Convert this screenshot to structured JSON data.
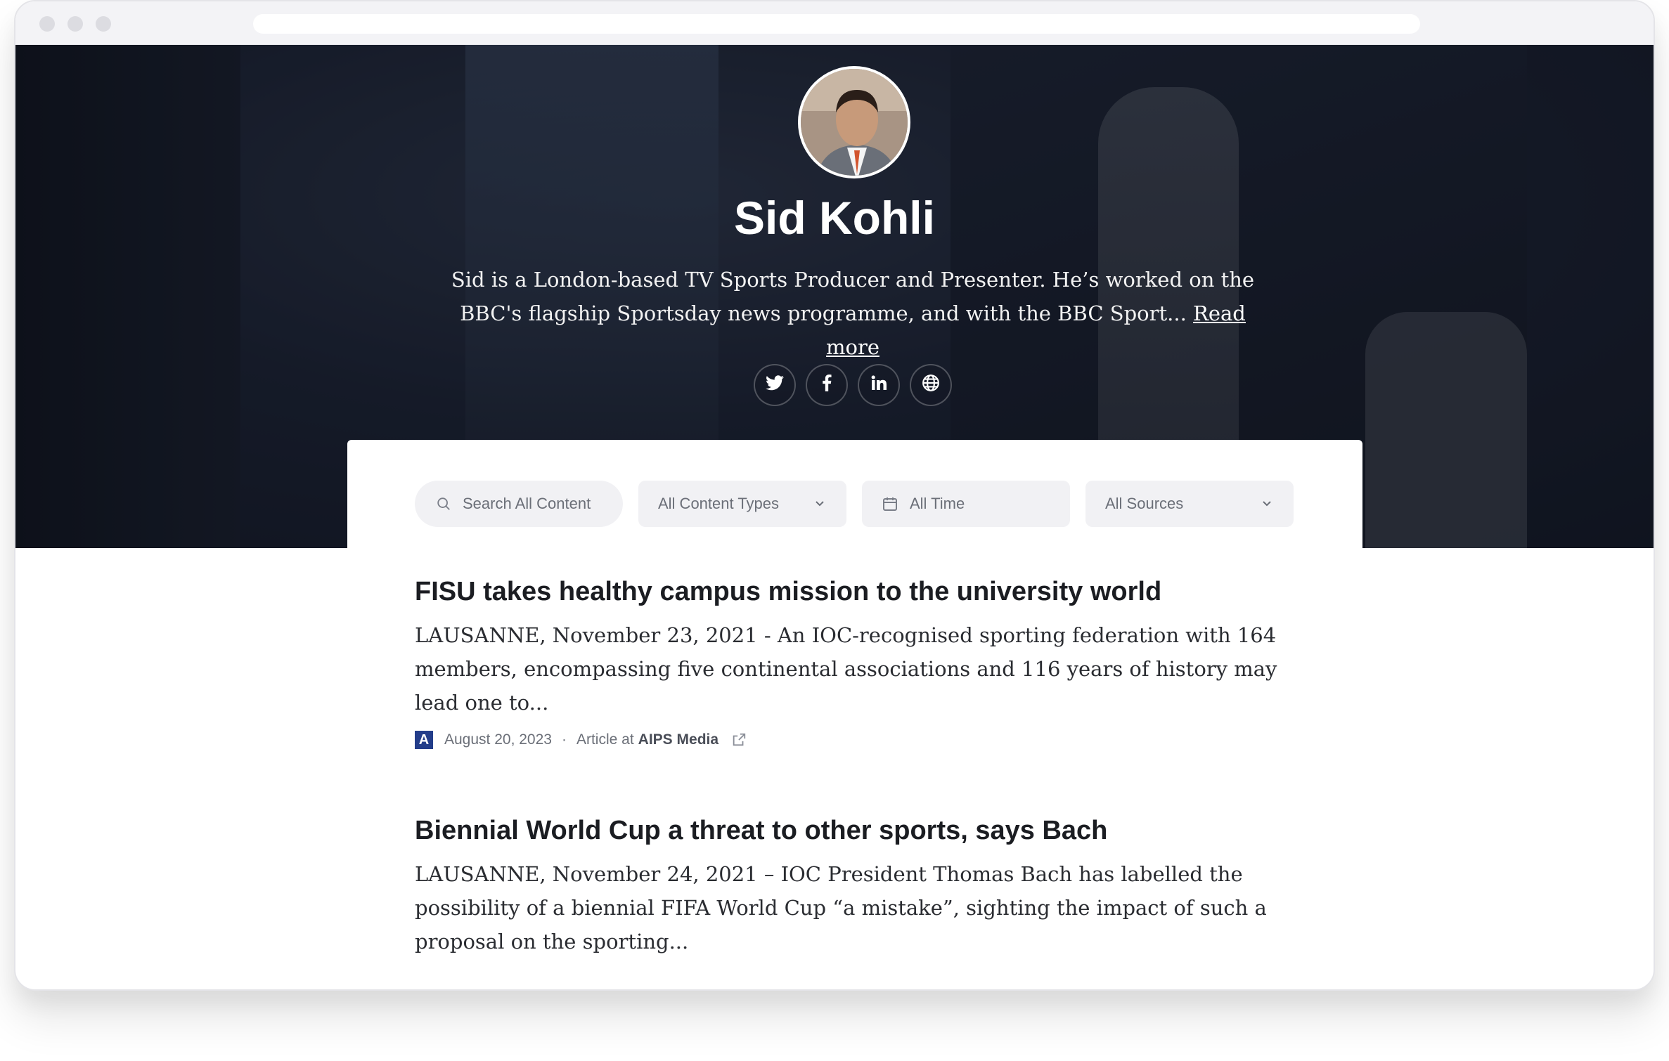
{
  "profile": {
    "name": "Sid Kohli",
    "bio": "Sid is a London-based TV Sports Producer and Presenter. He’s worked on the BBC's flagship Sportsday news programme, and with the BBC Sport...",
    "read_more": "Read more",
    "socials": [
      {
        "name": "twitter-icon"
      },
      {
        "name": "facebook-icon"
      },
      {
        "name": "linkedin-icon"
      },
      {
        "name": "globe-icon"
      }
    ]
  },
  "filters": {
    "search_placeholder": "Search All Content",
    "content_types": "All Content Types",
    "time": "All Time",
    "sources": "All Sources"
  },
  "articles": [
    {
      "title": "FISU takes healthy campus mission to the university world",
      "excerpt": "LAUSANNE, November 23, 2021 - An IOC-recognised sporting federation with 164 members, encompassing five continental associations and 116 years of history may lead one to...",
      "logo": "A",
      "date": "August 20, 2023",
      "separator": "·",
      "type": "Article at",
      "source": "AIPS Media"
    },
    {
      "title": "Biennial World Cup a threat to other sports, says Bach",
      "excerpt": "LAUSANNE, November 24, 2021 – IOC President Thomas Bach has labelled the possibility of a biennial FIFA World Cup “a mistake”, sighting the impact of such a proposal on the sporting..."
    }
  ],
  "colors": {
    "source_logo": "#233d8a",
    "hero_dark": "#161b27"
  }
}
